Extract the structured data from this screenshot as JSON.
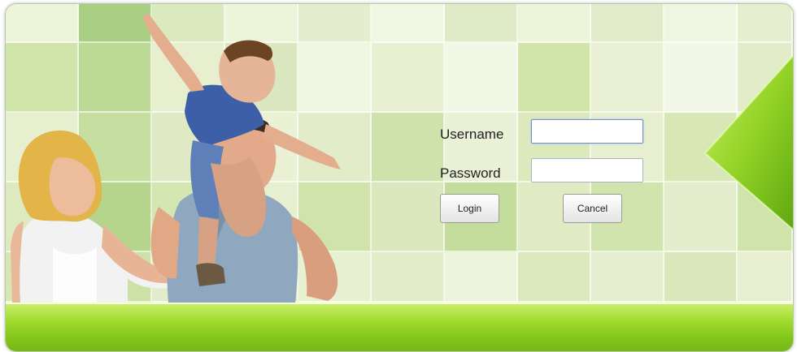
{
  "login": {
    "username_label": "Username",
    "password_label": "Password",
    "username_value": "",
    "password_value": "",
    "login_button": "Login",
    "cancel_button": "Cancel"
  },
  "theme": {
    "accent_green": "#8ccf1f",
    "tile_dark": "#b9d88a",
    "tile_light": "#eef4da"
  },
  "images": {
    "hero": "family-photo"
  }
}
